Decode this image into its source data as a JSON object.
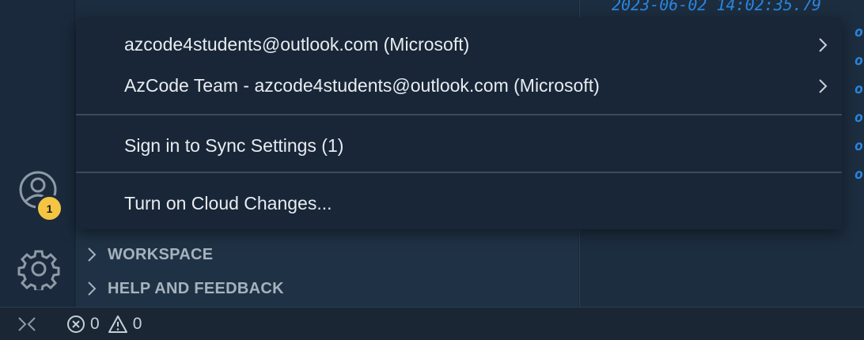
{
  "editor": {
    "timestamp_line": "2023-06-02 14:02:35.79",
    "fragment": "o"
  },
  "activity_bar": {
    "accounts_badge": "1",
    "accounts_icon": "account-icon",
    "manage_icon": "gear-icon"
  },
  "side_bar": {
    "sections": [
      {
        "label": "WORKSPACE"
      },
      {
        "label": "HELP AND FEEDBACK"
      }
    ]
  },
  "accounts_menu": {
    "items": [
      {
        "label": "azcode4students@outlook.com (Microsoft)",
        "has_submenu": true
      },
      {
        "label": "AzCode Team - azcode4students@outlook.com (Microsoft)",
        "has_submenu": true
      },
      {
        "label": "Sign in to Sync Settings (1)",
        "has_submenu": false
      },
      {
        "label": "Turn on Cloud Changes...",
        "has_submenu": false
      }
    ]
  },
  "status_bar": {
    "errors": "0",
    "warnings": "0"
  },
  "colors": {
    "badge": "#f4c542",
    "accent_text": "#2a86e0",
    "menu_bg": "#182638"
  }
}
